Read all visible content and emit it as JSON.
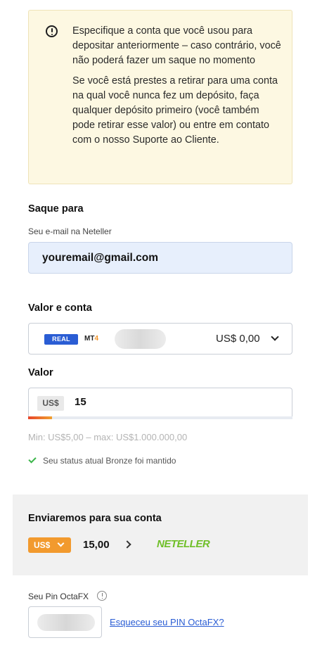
{
  "warning": {
    "icon": "alert-circle-icon",
    "paragraph1": "Especifique a conta que você usou para depositar anteriormente – caso contrário, você não poderá fazer um saque no momento",
    "paragraph2": "Se você está prestes a retirar para uma conta na qual você nunca fez um depósito, faça qualquer depósito primeiro (você também pode retirar esse valor) ou entre em contato com o nosso Suporte ao Cliente."
  },
  "withdraw_to": {
    "title": "Saque para",
    "email_label": "Seu e-mail na Neteller",
    "email_value": "youremail@gmail.com"
  },
  "account": {
    "title": "Valor e conta",
    "type_badge": "REAL",
    "platform_prefix": "MT",
    "platform_number": "4",
    "balance": "US$ 0,00"
  },
  "amount": {
    "title": "Valor",
    "currency": "US$",
    "value": "15",
    "progress_percent": 9,
    "limits": "Min: US$5,00 – max: US$1.000.000,00",
    "status_text": "Seu status atual Bronze foi mantido"
  },
  "send": {
    "title": "Enviaremos para sua conta",
    "currency": "US$",
    "amount": "15,00",
    "provider_logo": "NETELLER"
  },
  "pin": {
    "label": "Seu Pin OctaFX",
    "forgot_link": "Esqueceu seu PIN OctaFX?"
  },
  "colors": {
    "warning_bg": "#fdf8e2",
    "accent_blue": "#2a5dd4",
    "accent_orange": "#f29a2e",
    "neteller_green": "#6fbf28",
    "success_green": "#3bb54a"
  }
}
